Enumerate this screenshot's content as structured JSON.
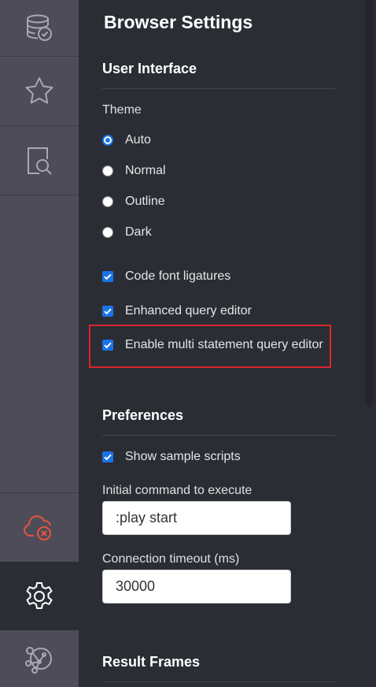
{
  "sidebar": {
    "items": [
      {
        "icon": "database-check-icon"
      },
      {
        "icon": "star-icon"
      },
      {
        "icon": "document-search-icon"
      },
      {
        "icon": "cloud-disconnected-icon",
        "color": "#e5553d"
      },
      {
        "icon": "gear-icon",
        "active": true
      },
      {
        "icon": "graph-icon"
      }
    ]
  },
  "page": {
    "title": "Browser Settings"
  },
  "user_interface": {
    "title": "User Interface",
    "theme_label": "Theme",
    "theme_options": [
      {
        "label": "Auto",
        "checked": true
      },
      {
        "label": "Normal",
        "checked": false
      },
      {
        "label": "Outline",
        "checked": false
      },
      {
        "label": "Dark",
        "checked": false
      }
    ],
    "checkboxes": [
      {
        "label": "Code font ligatures",
        "checked": true
      },
      {
        "label": "Enhanced query editor",
        "checked": true
      },
      {
        "label": "Enable multi statement query editor",
        "checked": true
      }
    ]
  },
  "preferences": {
    "title": "Preferences",
    "show_sample_scripts": {
      "label": "Show sample scripts",
      "checked": true
    },
    "initial_command": {
      "label": "Initial command to execute",
      "value": ":play start"
    },
    "connection_timeout": {
      "label": "Connection timeout (ms)",
      "value": "30000"
    }
  },
  "result_frames": {
    "title": "Result Frames"
  },
  "colors": {
    "accent": "#1a73e8",
    "highlight": "#d9262a",
    "disconnected": "#e5553d"
  }
}
